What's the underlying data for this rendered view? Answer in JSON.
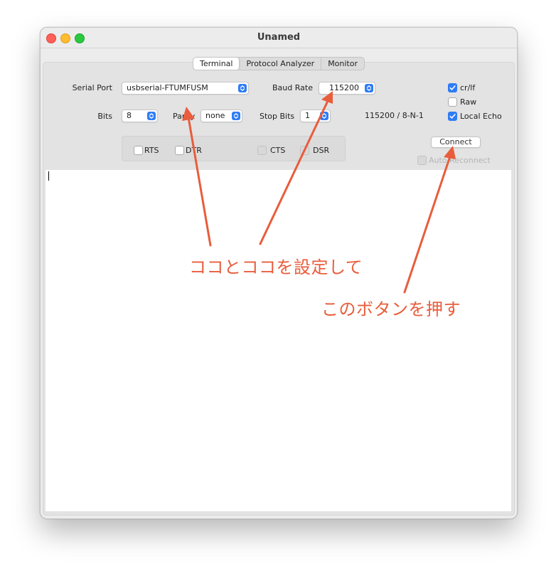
{
  "window": {
    "title": "Unamed"
  },
  "tabs": [
    {
      "label": "Terminal",
      "active": true
    },
    {
      "label": "Protocol Analyzer",
      "active": false
    },
    {
      "label": "Monitor",
      "active": false
    }
  ],
  "settings": {
    "serial_port_label": "Serial Port",
    "serial_port_value": "usbserial-FTUMFUSM",
    "baud_rate_label": "Baud Rate",
    "baud_rate_value": "115200",
    "bits_label": "Bits",
    "bits_value": "8",
    "parity_label": "Parity",
    "parity_value": "none",
    "stop_bits_label": "Stop Bits",
    "stop_bits_value": "1",
    "summary": "115200 / 8-N-1"
  },
  "options": {
    "crlf": {
      "label": "cr/lf",
      "checked": true
    },
    "raw": {
      "label": "Raw",
      "checked": false
    },
    "local_echo": {
      "label": "Local Echo",
      "checked": true
    }
  },
  "signals": {
    "rts": {
      "label": "RTS",
      "checked": false
    },
    "dtr": {
      "label": "DTR",
      "checked": false
    },
    "cts": {
      "label": "CTS",
      "checked": false
    },
    "dsr": {
      "label": "DSR",
      "checked": false
    }
  },
  "connect": {
    "button_label": "Connect",
    "auto_reconnect_label": "Auto Reconnect",
    "auto_reconnect_checked": false
  },
  "annotations": {
    "set_here": "ココとココを設定して",
    "press_button": "このボタンを押す",
    "color": "#e85d3c"
  }
}
